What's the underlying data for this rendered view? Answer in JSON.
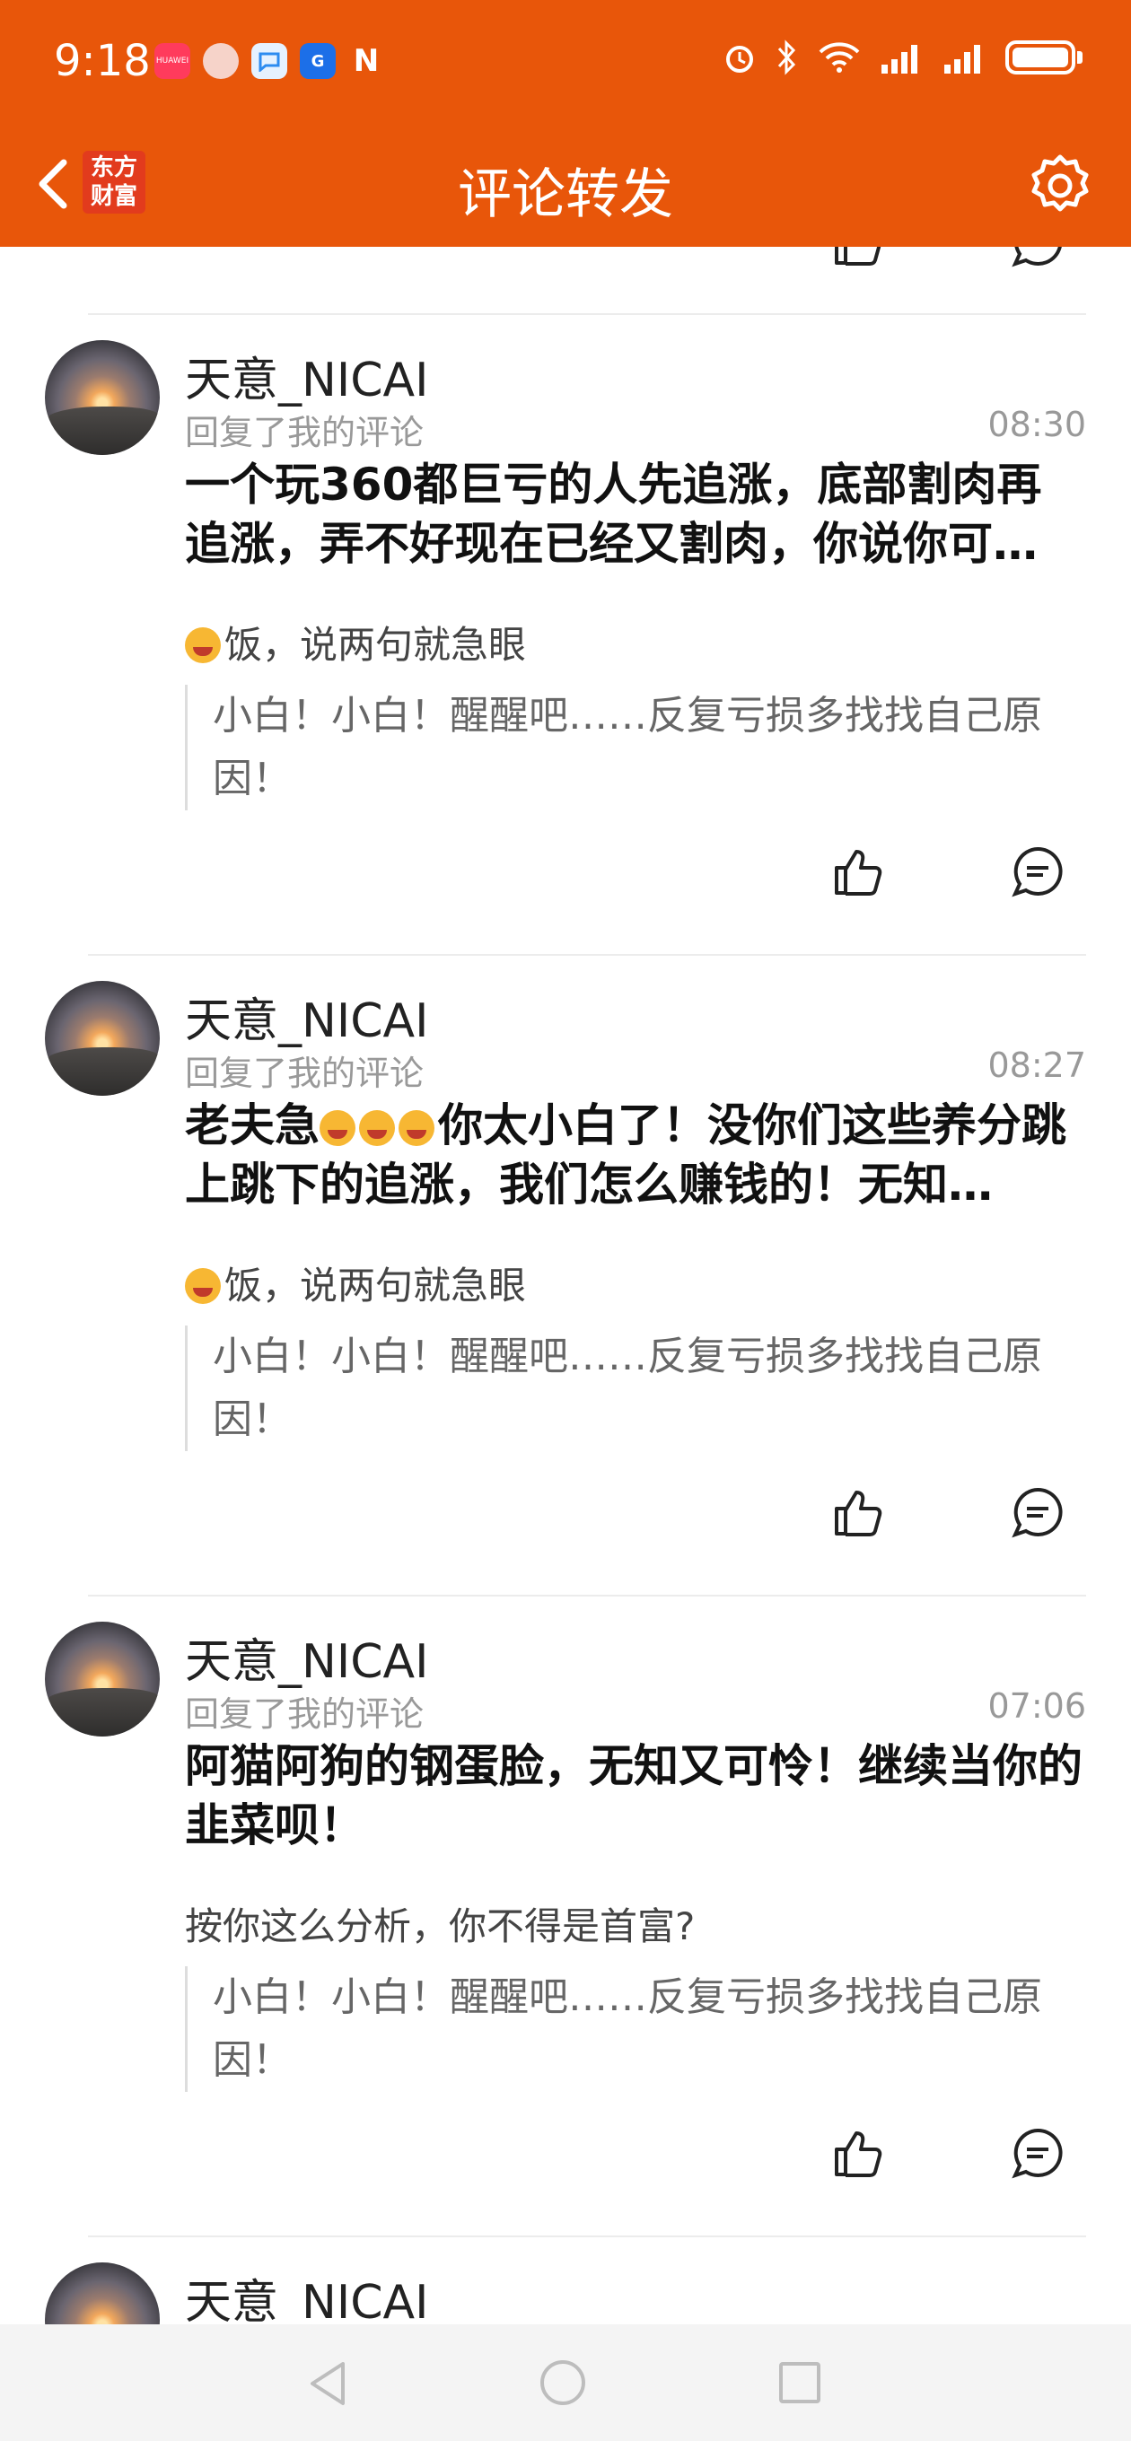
{
  "status_bar": {
    "time": "9:18",
    "app_icons": [
      "huawei-icon",
      "avatar-app-icon",
      "chat-app-icon",
      "browser-app-icon",
      "nfc-icon"
    ],
    "right_icons": [
      "alarm-icon",
      "bluetooth-icon",
      "wifi-icon",
      "signal-icon",
      "signal-icon",
      "battery-icon"
    ],
    "huawei_label": "HUAWEI"
  },
  "header": {
    "logo_line1": "东方",
    "logo_line2": "财富",
    "title": "评论转发",
    "accent_color": "#e8560a"
  },
  "comments": [
    {
      "username": "天意_NICAI",
      "subtitle": "回复了我的评论",
      "time": "08:30",
      "body": "一个玩360都巨亏的人先追涨，底部割肉再追涨，弄不好现在已经又割肉，你说你可…",
      "reply": "饭，说两句就急眼",
      "quote": "小白！小白！醒醒吧……反复亏损多找找自己原因！"
    },
    {
      "username": "天意_NICAI",
      "subtitle": "回复了我的评论",
      "time": "08:27",
      "body_prefix": "老夫急",
      "body_suffix": "你太小白了！没你们这些养分跳上跳下的追涨，我们怎么赚钱的！无知…",
      "reply": "饭，说两句就急眼",
      "quote": "小白！小白！醒醒吧……反复亏损多找找自己原因！"
    },
    {
      "username": "天意_NICAI",
      "subtitle": "回复了我的评论",
      "time": "07:06",
      "body": "阿猫阿狗的钢蛋脸，无知又可怜！继续当你的韭菜呗！",
      "reply": "按你这么分析，你不得是首富?",
      "quote": "小白！小白！醒醒吧……反复亏损多找找自己原因！"
    },
    {
      "username": "天意_NICAI"
    }
  ]
}
